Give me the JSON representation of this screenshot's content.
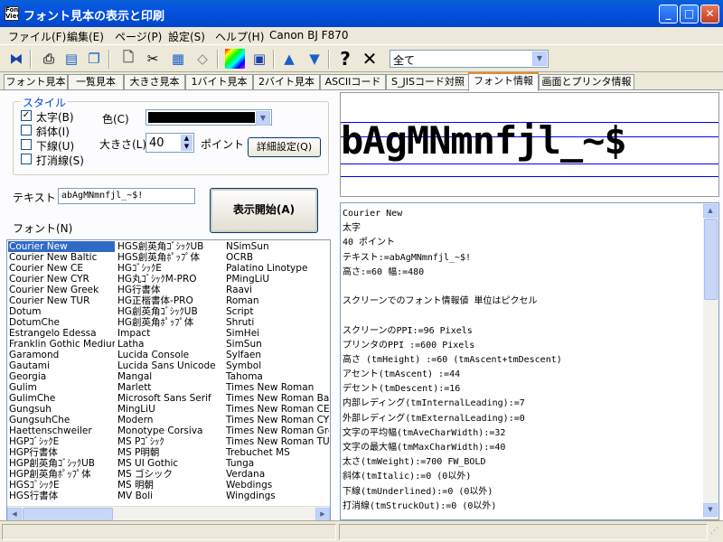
{
  "window": {
    "title": "フォント見本の表示と印刷",
    "icon_text": "Font View",
    "min": "_",
    "max": "□",
    "close": "✕"
  },
  "menu": [
    {
      "label": "ファイル(F)"
    },
    {
      "label": "編集(E)"
    },
    {
      "label": "ページ(P)"
    },
    {
      "label": "設定(S)"
    },
    {
      "label": "ヘルプ(H)"
    },
    {
      "label": "Canon BJ F870"
    }
  ],
  "toolbar": {
    "icons": [
      "first-page-icon",
      "print-preview-icon",
      "export-icon",
      "copy-icon",
      "new-page-icon",
      "cut-icon",
      "paste-icon",
      "eraser-icon",
      "color-palette-icon",
      "save-icon",
      "arrow-up-icon",
      "arrow-down-icon",
      "help-icon",
      "close-icon"
    ],
    "filter_value": "全て"
  },
  "tabs": [
    {
      "label": "フォント見本"
    },
    {
      "label": "一覧見本"
    },
    {
      "label": "大きさ見本"
    },
    {
      "label": "1バイト見本"
    },
    {
      "label": "2バイト見本"
    },
    {
      "label": "ASCIIコード"
    },
    {
      "label": "S_JISコード対照"
    },
    {
      "label": "フォント情報"
    },
    {
      "label": "画面とプリンタ情報"
    }
  ],
  "active_tab": "フォント情報",
  "style": {
    "group_title": "スタイル",
    "bold": {
      "label": "太字(B)",
      "checked": true
    },
    "italic": {
      "label": "斜体(I)",
      "checked": false
    },
    "underline": {
      "label": "下線(U)",
      "checked": false
    },
    "strike": {
      "label": "打消線(S)",
      "checked": false
    },
    "color_label": "色(C)",
    "color_value": "#000000",
    "size_label": "大きさ(L)",
    "size_value": "40",
    "size_unit": "ポイント",
    "detail_button": "詳細設定(Q)"
  },
  "text_label": "テキスト",
  "text_value": "abAgMNmnfjl_~$!",
  "start_button": "表示開始(A)",
  "font_label": "フォント(N)",
  "fonts": {
    "col1": [
      "Courier New",
      "Courier New Baltic",
      "Courier New CE",
      "Courier New CYR",
      "Courier New Greek",
      "Courier New TUR",
      "Dotum",
      "DotumChe",
      "Estrangelo Edessa",
      "Franklin Gothic Medium",
      "Garamond",
      "Gautami",
      "Georgia",
      "Gulim",
      "GulimChe",
      "Gungsuh",
      "GungsuhChe",
      "Haettenschweiler",
      "HGPｺﾞｼｯｸE",
      "HGP行書体",
      "HGP創英角ｺﾞｼｯｸUB",
      "HGP創英角ﾎﾟｯﾌﾟ体",
      "HGSｺﾞｼｯｸE",
      "HGS行書体"
    ],
    "col2": [
      "HGS創英角ｺﾞｼｯｸUB",
      "HGS創英角ﾎﾟｯﾌﾟ体",
      "HGｺﾞｼｯｸE",
      "HG丸ｺﾞｼｯｸM-PRO",
      "HG行書体",
      "HG正楷書体-PRO",
      "HG創英角ｺﾞｼｯｸUB",
      "HG創英角ﾎﾟｯﾌﾟ体",
      "Impact",
      "Latha",
      "Lucida Console",
      "Lucida Sans Unicode",
      "Mangal",
      "Marlett",
      "Microsoft Sans Serif",
      "MingLiU",
      "Modern",
      "Monotype Corsiva",
      "MS Pｺﾞｼｯｸ",
      "MS P明朝",
      "MS UI Gothic",
      "MS ゴシック",
      "MS 明朝",
      "MV Boli"
    ],
    "col3": [
      "NSimSun",
      "OCRB",
      "Palatino Linotype",
      "PMingLiU",
      "Raavi",
      "Roman",
      "Script",
      "Shruti",
      "SimHei",
      "SimSun",
      "Sylfaen",
      "Symbol",
      "Tahoma",
      "Times New Roman",
      "Times New Roman Baltic",
      "Times New Roman CE",
      "Times New Roman CYR",
      "Times New Roman Greek",
      "Times New Roman TUR",
      "Trebuchet MS",
      "Tunga",
      "Verdana",
      "Webdings",
      "Wingdings"
    ],
    "selected": "Courier New"
  },
  "preview_text": "bAgMNmnfjl_~$",
  "info_lines": [
    "Courier New",
    "太字",
    "40 ポイント",
    "テキスト:=abAgMNmnfjl_~$!",
    "高さ:=60  幅:=480",
    "",
    "スクリーンでのフォント情報値  単位はピクセル",
    "",
    "スクリーンのPPI:=96 Pixels",
    "プリンタのPPI  :=600 Pixels",
    "高さ    (tmHeight) :=60 (tmAscent+tmDescent)",
    "アセント(tmAscent) :=44",
    "デセント(tmDescent):=16",
    "内部レディング(tmInternalLeading):=7",
    "外部レディング(tmExternalLeading):=0",
    "文字の平均幅(tmAveCharWidth):=32",
    "文字の最大幅(tmMaxCharWidth):=40",
    "太さ(tmWeight):=700 FW_BOLD",
    "斜体(tmItalic):=0 (0以外)",
    "下線(tmUnderlined):=0 (0以外)",
    "打消線(tmStruckOut):=0 (0以外)"
  ]
}
